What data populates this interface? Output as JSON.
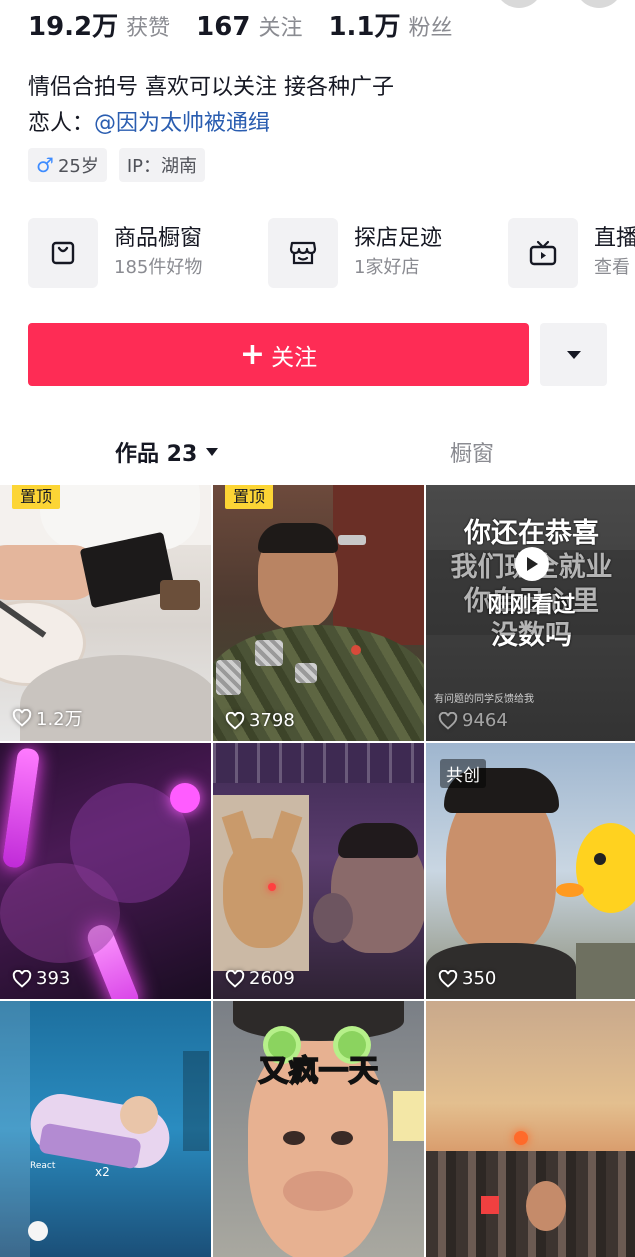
{
  "stats": {
    "likes_num": "19.2万",
    "likes_label": "获赞",
    "following_num": "167",
    "following_label": "关注",
    "followers_num": "1.1万",
    "followers_label": "粉丝"
  },
  "bio": {
    "line1": "情侣合拍号 喜欢可以关注 接各种广子",
    "lover_prefix": "恋人：",
    "lover_mention": "@因为太帅被通缉"
  },
  "tags": {
    "gender_icon": "male-icon",
    "age": "25岁",
    "ip": "IP：湖南"
  },
  "features": [
    {
      "icon": "shopping-bag-icon",
      "title": "商品橱窗",
      "subtitle": "185件好物"
    },
    {
      "icon": "shop-icon",
      "title": "探店足迹",
      "subtitle": "1家好店"
    },
    {
      "icon": "tv-icon",
      "title": "直播",
      "subtitle": "查看"
    }
  ],
  "follow_button": {
    "label": "关注"
  },
  "tabs": {
    "works_label": "作品 23",
    "showcase_label": "橱窗"
  },
  "colors": {
    "accent": "#fe2c55",
    "pin_badge": "#fcd535",
    "mention": "#2a5db0"
  },
  "videos": [
    {
      "pin": "置顶",
      "likes": "1.2万"
    },
    {
      "pin": "置顶",
      "likes": "3798"
    },
    {
      "overlay": [
        "你还在恭喜",
        "我们班全就业",
        "你自己心里",
        "没数吗"
      ],
      "watched": "刚刚看过",
      "caption": "有问题的同学反馈给我",
      "likes": "9464"
    },
    {
      "likes": "393"
    },
    {
      "likes": "2609"
    },
    {
      "collab": "共创",
      "likes": "350"
    },
    {
      "small_text": "React",
      "count": "x2"
    },
    {
      "overlay": "又疯一天"
    },
    {}
  ]
}
